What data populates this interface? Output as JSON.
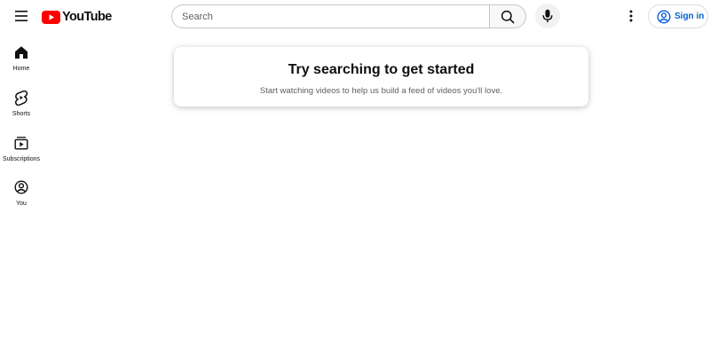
{
  "header": {
    "logo_text": "YouTube",
    "search_placeholder": "Search",
    "search_value": "",
    "signin_label": "Sign in"
  },
  "sidebar": {
    "items": [
      {
        "label": "Home",
        "icon": "home-icon"
      },
      {
        "label": "Shorts",
        "icon": "shorts-icon"
      },
      {
        "label": "Subscriptions",
        "icon": "subscriptions-icon"
      },
      {
        "label": "You",
        "icon": "you-icon"
      }
    ]
  },
  "main": {
    "title": "Try searching to get started",
    "subtitle": "Start watching videos to help us build a feed of videos you'll love."
  },
  "colors": {
    "brand_red": "#ff0000",
    "link_blue": "#065fd4",
    "text_primary": "#0f0f0f",
    "text_secondary": "#606060"
  }
}
